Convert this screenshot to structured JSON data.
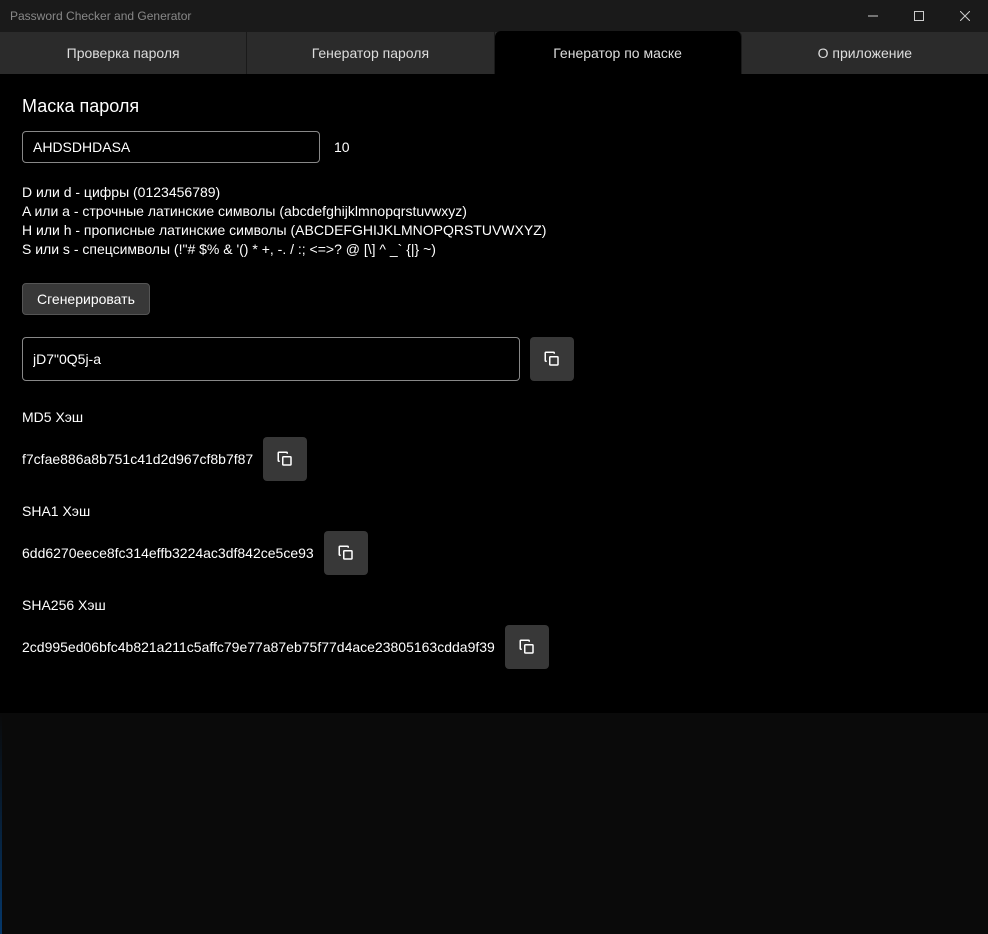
{
  "window": {
    "title": "Password Checker and Generator"
  },
  "tabs": [
    {
      "label": "Проверка пароля",
      "active": false
    },
    {
      "label": "Генератор пароля",
      "active": false
    },
    {
      "label": "Генератор по маске",
      "active": true
    },
    {
      "label": "О приложение",
      "active": false
    }
  ],
  "mask": {
    "title": "Маска пароля",
    "value": "AHDSDHDASA",
    "count": "10"
  },
  "help": {
    "line1": "D или d - цифры (0123456789)",
    "line2": "A или a - строчные латинские символы (abcdefghijklmnopqrstuvwxyz)",
    "line3": "H или h - прописные латинские символы (ABCDEFGHIJKLMNOPQRSTUVWXYZ)",
    "line4": "S или s - спецсимволы (!\"# $% & '() * +, -. / :; <=>? @ [\\] ^ _` {|} ~)"
  },
  "generate": {
    "label": "Сгенерировать"
  },
  "result": {
    "value": "jD7\"0Q5j-a"
  },
  "hashes": {
    "md5": {
      "label": "MD5 Хэш",
      "value": "f7cfae886a8b751c41d2d967cf8b7f87"
    },
    "sha1": {
      "label": "SHA1 Хэш",
      "value": "6dd6270eece8fc314effb3224ac3df842ce5ce93"
    },
    "sha256": {
      "label": "SHA256 Хэш",
      "value": "2cd995ed06bfc4b821a211c5affc79e77a87eb75f77d4ace23805163cdda9f39"
    }
  }
}
